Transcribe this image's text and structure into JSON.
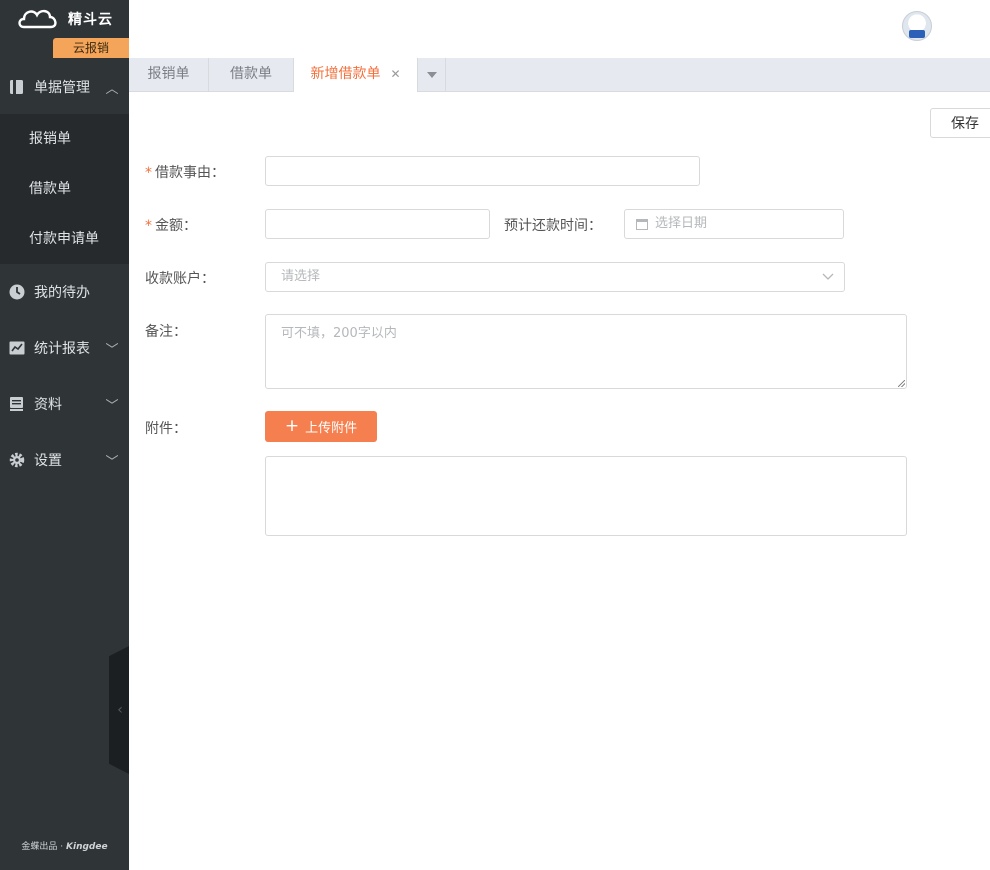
{
  "brand": {
    "name": "精斗云",
    "product_badge": "云报销"
  },
  "sidebar": {
    "groups": [
      {
        "label": "单据管理",
        "icon": "book-icon",
        "chevron": "up",
        "children": [
          "报销单",
          "借款单",
          "付款申请单"
        ]
      },
      {
        "label": "我的待办",
        "icon": "clock-icon"
      },
      {
        "label": "统计报表",
        "icon": "chart-icon",
        "chevron": "down"
      },
      {
        "label": "资料",
        "icon": "stack-icon",
        "chevron": "down"
      },
      {
        "label": "设置",
        "icon": "gear-icon",
        "chevron": "down"
      }
    ],
    "footer_prefix": "金蝶出品 · ",
    "footer_brand": "Kingdee"
  },
  "tabs": [
    {
      "label": "报销单",
      "active": false
    },
    {
      "label": "借款单",
      "active": false
    },
    {
      "label": "新增借款单",
      "active": true,
      "closable": true
    }
  ],
  "toolbar": {
    "save_label": "保存"
  },
  "form": {
    "reason_label": "借款事由：",
    "amount_label": "金额：",
    "repay_label": "预计还款时间：",
    "date_placeholder": "选择日期",
    "account_label": "收款账户：",
    "account_placeholder": "请选择",
    "remark_label": "备注：",
    "remark_placeholder": "可不填，200字以内",
    "attachment_label": "附件：",
    "upload_label": "上传附件"
  },
  "colors": {
    "accent": "#f3703c",
    "sidebar": "#2f3437",
    "badge": "#f5a55a"
  }
}
